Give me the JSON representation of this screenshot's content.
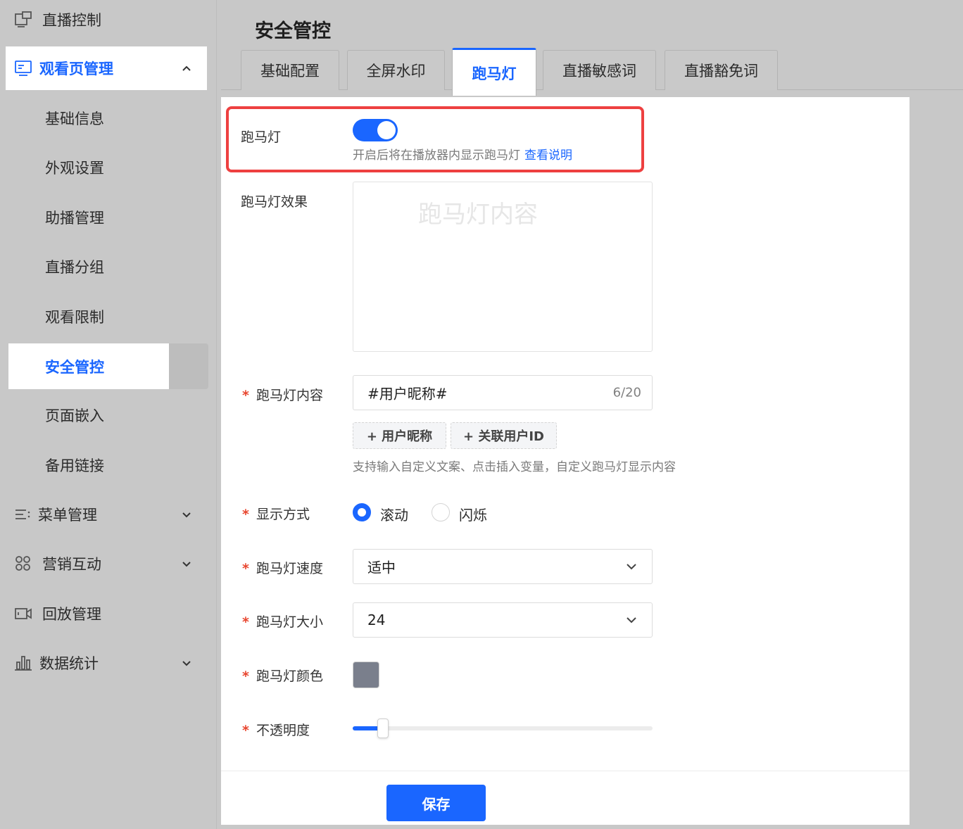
{
  "sidebar": {
    "live_control": "直播控制",
    "watch_page": "观看页管理",
    "sub_items": [
      "基础信息",
      "外观设置",
      "助播管理",
      "直播分组",
      "观看限制",
      "安全管控",
      "页面嵌入",
      "备用链接"
    ],
    "menu_manage": "菜单管理",
    "marketing": "营销互动",
    "replay": "回放管理",
    "stats": "数据统计"
  },
  "header": {
    "title": "安全管控"
  },
  "tabs": [
    "基础配置",
    "全屏水印",
    "跑马灯",
    "直播敏感词",
    "直播豁免词"
  ],
  "active_tab": "跑马灯",
  "form": {
    "marquee_label": "跑马灯",
    "marquee_enabled": true,
    "marquee_hint": "开启后将在播放器内显示跑马灯",
    "marquee_link": "查看说明",
    "effect_label": "跑马灯效果",
    "effect_preview_text": "跑马灯内容",
    "content_label": "跑马灯内容",
    "content_value": "#用户昵称#",
    "content_count": "6/20",
    "var_nickname": "+ 用户昵称",
    "var_userid": "+ 关联用户ID",
    "content_hint": "支持输入自定义文案、点击插入变量，自定义跑马灯显示内容",
    "display_label": "显示方式",
    "display_options": [
      "滚动",
      "闪烁"
    ],
    "display_selected": "滚动",
    "speed_label": "跑马灯速度",
    "speed_value": "适中",
    "size_label": "跑马灯大小",
    "size_value": "24",
    "color_label": "跑马灯颜色",
    "color_value": "#7a7f8c",
    "opacity_label": "不透明度",
    "opacity_fraction": 0.1,
    "required_mark": "*",
    "save_label": "保存"
  },
  "colors": {
    "accent": "#1a66ff",
    "required": "#e8452e",
    "highlight": "#ee4040"
  }
}
